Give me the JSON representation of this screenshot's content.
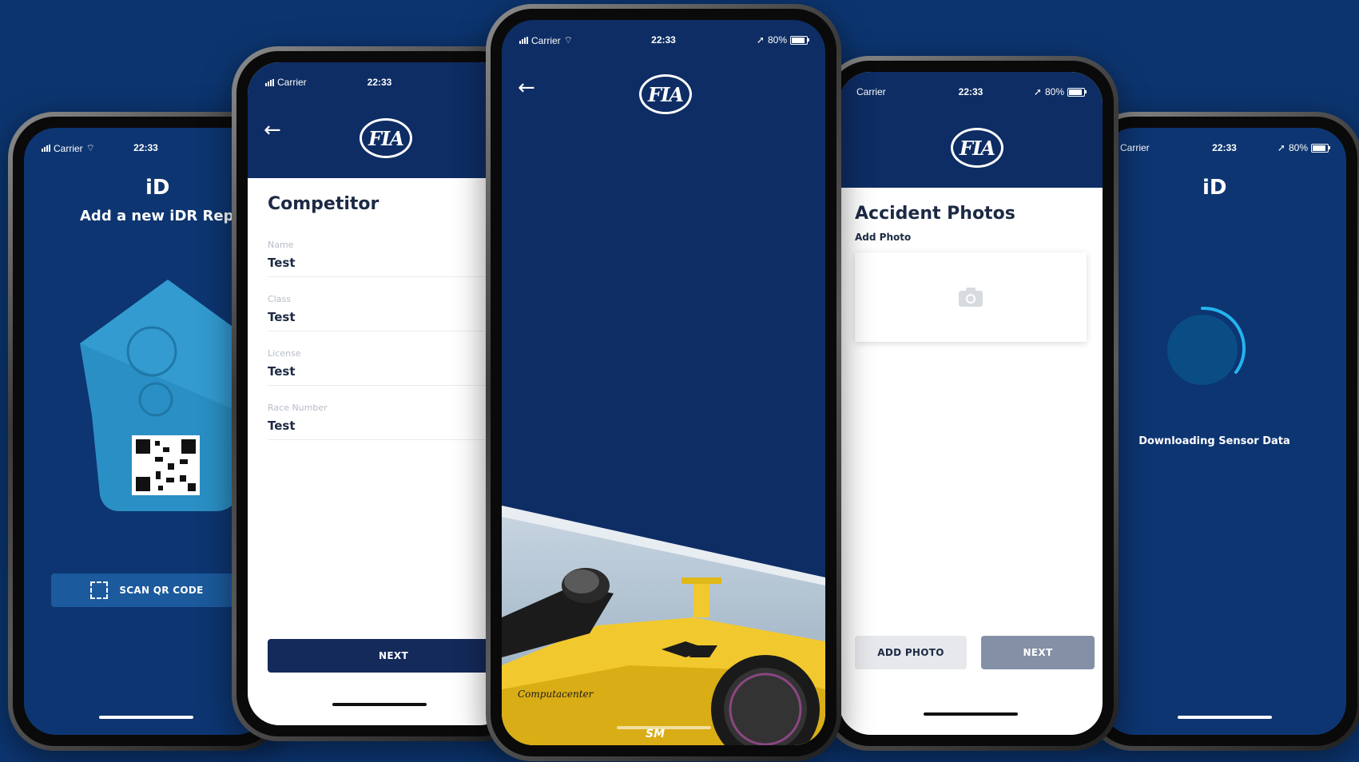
{
  "status_bar": {
    "carrier": "Carrier",
    "time": "22:33",
    "battery": "80%"
  },
  "screen1": {
    "title": "Add a new iDR Report",
    "scan_button": "SCAN QR CODE"
  },
  "screen2": {
    "title": "Competitor",
    "fields": [
      {
        "label": "Name",
        "value": "Test"
      },
      {
        "label": "Class",
        "value": "Test"
      },
      {
        "label": "License",
        "value": "Test"
      },
      {
        "label": "Race Number",
        "value": "Test"
      }
    ],
    "next_button": "NEXT"
  },
  "screen3": {
    "logo_text": "FIA"
  },
  "screen4": {
    "title": "Accident Photos",
    "subtitle": "Add Photo",
    "add_photo_button": "ADD PHOTO",
    "next_button": "NEXT"
  },
  "screen5": {
    "status_text": "Downloading Sensor Data"
  },
  "colors": {
    "background": "#0c3570",
    "primary": "#0e2d64",
    "accent": "#1aa7e0",
    "button_dark": "#132a5a"
  }
}
